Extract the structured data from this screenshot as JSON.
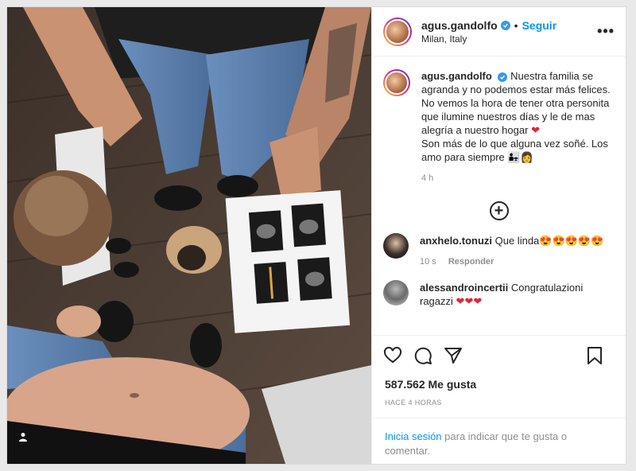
{
  "post": {
    "username": "agus.gandolfo",
    "follow_label": "Seguir",
    "separator": "•",
    "location": "Milan, Italy",
    "more_label": "•••"
  },
  "caption": {
    "username": "agus.gandolfo",
    "text_1": "Nuestra familia se agranda y no podemos estar más felices. No vemos la hora de tener otra personita que ilumine nuestros días y le de mas alegría a nuestro hogar",
    "text_2": "Son más de lo que alguna vez soñé. Los amo para siempre",
    "heart": "❤",
    "family_emoji": "👨‍👧‍👩",
    "time": "4 h"
  },
  "load_more": "+",
  "comments": [
    {
      "username": "anxhelo.tonuzi",
      "text": "Que linda",
      "emoji": "😍😍😍😍😍",
      "time": "10 s",
      "reply_label": "Responder"
    },
    {
      "username": "alessandroincertii",
      "text": "Congratulazioni ragazzi",
      "emoji": "❤❤❤"
    }
  ],
  "likes": "587.562 Me gusta",
  "posted_ago": "HACE 4 HORAS",
  "login_prompt": {
    "link": "Inicia sesión",
    "rest": " para indicar que te gusta o comentar."
  },
  "colors": {
    "accent": "#0095f6",
    "verified": "#3897f0",
    "heart": "#e0263a"
  },
  "icons": [
    "verified-icon",
    "more-options-icon",
    "add-comment-icon",
    "heart-icon",
    "comment-icon",
    "share-icon",
    "bookmark-icon",
    "user-tag-icon"
  ]
}
